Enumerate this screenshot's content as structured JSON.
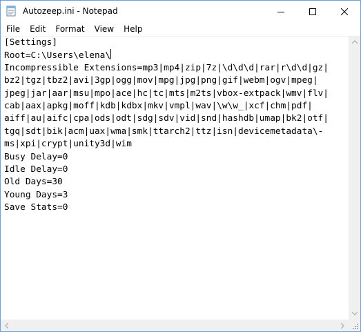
{
  "window": {
    "title": "Autozeep.ini - Notepad"
  },
  "menu": {
    "items": [
      "File",
      "Edit",
      "Format",
      "View",
      "Help"
    ]
  },
  "editor": {
    "lines": [
      "[Settings]",
      "Root=C:\\Users\\elena\\",
      "Incompressible Extensions=mp3|mp4|zip|7z|\\d\\d\\d|rar|r\\d\\d|gz|",
      "bz2|tgz|tbz2|avi|3gp|ogg|mov|mpg|jpg|png|gif|webm|ogv|mpeg|",
      "jpeg|jar|aar|msu|mpo|ace|hc|tc|mts|m2ts|vbox-extpack|wmv|flv|",
      "cab|aax|apkg|moff|kdb|kdbx|mkv|vmpl|wav|\\w\\w_|xcf|chm|pdf|",
      "aiff|au|aifc|cpa|ods|odt|sdg|sdv|vid|snd|hashdb|umap|bk2|otf|",
      "tgq|sdt|bik|acm|uax|wma|smk|ttarch2|ttz|isn|devicemetadata\\-",
      "ms|xpi|crypt|unity3d|wim",
      "Busy Delay=0",
      "Idle Delay=0",
      "Old Days=30",
      "Young Days=3",
      "Save Stats=0"
    ]
  }
}
